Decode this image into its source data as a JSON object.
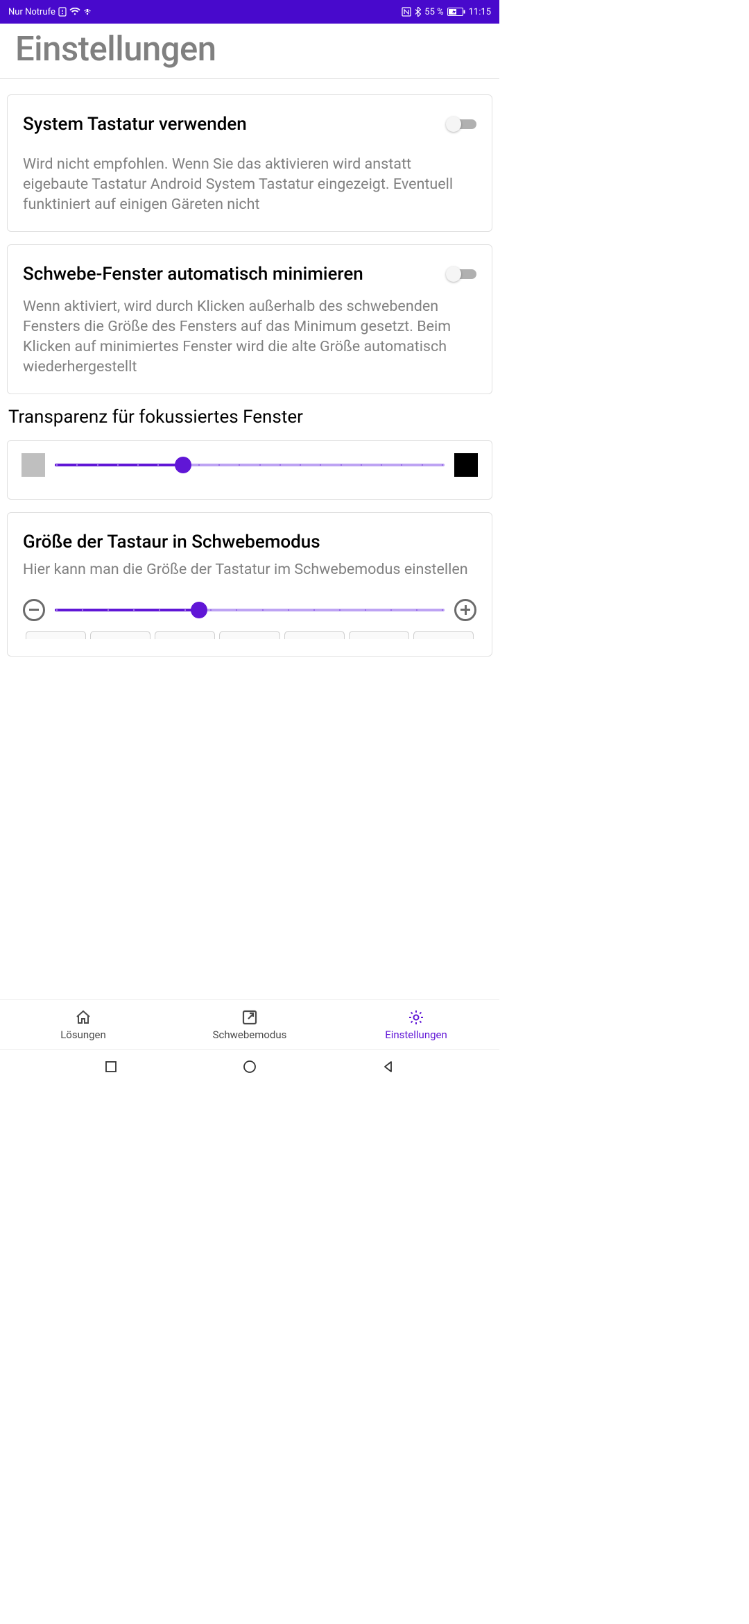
{
  "status": {
    "network": "Nur Notrufe",
    "battery": "55 %",
    "time": "11:15"
  },
  "header": {
    "title": "Einstellungen"
  },
  "cards": {
    "systemKeyboard": {
      "title": "System Tastatur verwenden",
      "desc": "Wird nicht empfohlen. Wenn Sie das aktivieren wird anstatt eigebaute Tastatur Android System Tastatur eingezeigt. Eventuell funktiniert auf einigen Gäreten nicht",
      "enabled": false
    },
    "autoMinimize": {
      "title": "Schwebe-Fenster automatisch minimieren",
      "desc": "Wenn aktiviert, wird durch Klicken außerhalb des schwebenden Fensters die Größe des Fensters auf das Minimum gesetzt. Beim Klicken auf minimiertes Fenster wird die alte Größe automatisch wiederhergestellt",
      "enabled": false
    },
    "transparency": {
      "label": "Transparenz für fokussiertes Fenster",
      "value_pct": 33
    },
    "keyboardSize": {
      "title": "Größe der Tastaur in Schwebemodus",
      "desc": "Hier kann man die Größe der Tastatur im Schwebemodus einstellen",
      "value_pct": 37
    }
  },
  "tabs": {
    "solutions": "Lösungen",
    "floating": "Schwebemodus",
    "settings": "Einstellungen"
  }
}
